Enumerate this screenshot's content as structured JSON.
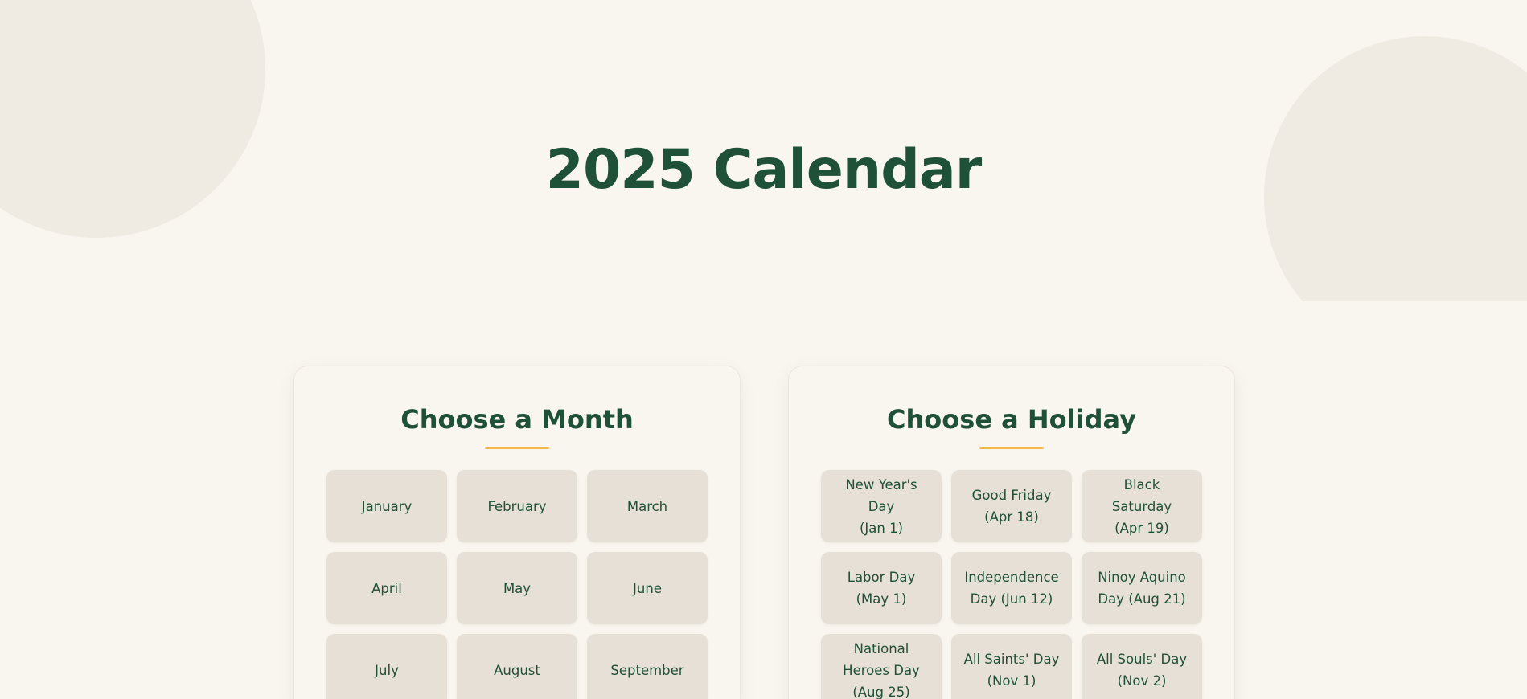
{
  "page": {
    "title": "2025 Calendar"
  },
  "month_card": {
    "title": "Choose a Month",
    "months": [
      "January",
      "February",
      "March",
      "April",
      "May",
      "June",
      "July",
      "August",
      "September"
    ]
  },
  "holiday_card": {
    "title": "Choose a Holiday",
    "holidays": [
      "New Year's\nDay\n(Jan 1)",
      "Good Friday\n(Apr 18)",
      "Black\nSaturday\n(Apr 19)",
      "Labor Day\n(May 1)",
      "Independence\nDay (Jun 12)",
      "Ninoy Aquino\nDay (Aug 21)",
      "National\nHeroes Day\n(Aug 25)",
      "All Saints' Day\n(Nov 1)",
      "All Souls' Day\n(Nov 2)"
    ]
  },
  "colors": {
    "background": "#f9f5ef",
    "primary_green": "#1f5038",
    "accent_gold": "#f2b84b",
    "tile": "#e6e0d7"
  }
}
